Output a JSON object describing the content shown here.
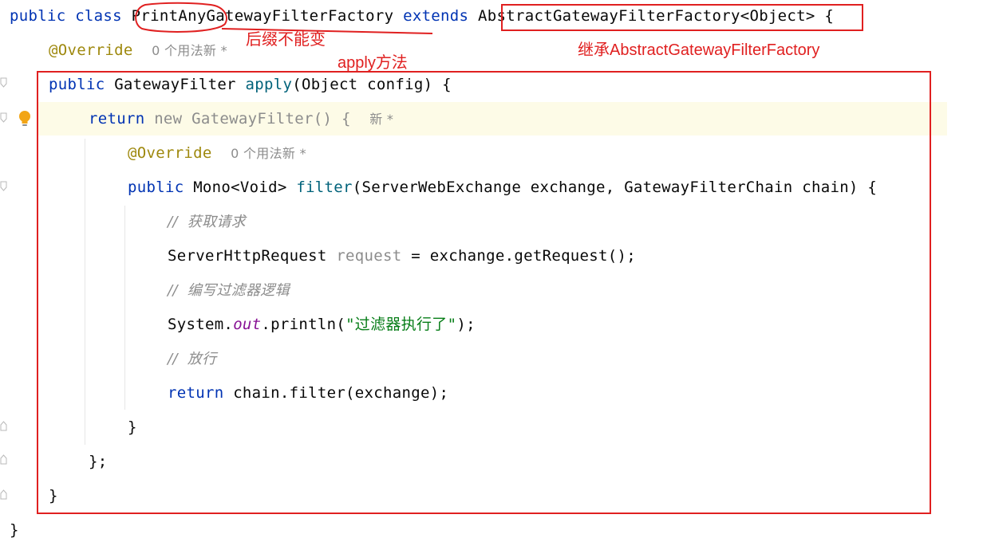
{
  "code": {
    "line1": {
      "kw1": "public",
      "kw2": "class",
      "class_name": "PrintAnyGatewayFilterFactory",
      "kw3": "extends",
      "parent": "AbstractGatewayFilterFactory<Object>",
      "brace": "{"
    },
    "line2": {
      "annotation": "@Override",
      "usages": "0 个用法",
      "mark": "新 *"
    },
    "line3": {
      "kw": "public",
      "type": "GatewayFilter",
      "method": "apply",
      "params": "(Object config) {"
    },
    "line4": {
      "kw": "return",
      "kw_new": "new",
      "type": "GatewayFilter() {",
      "mark": "新 *"
    },
    "line5": {
      "annotation": "@Override",
      "usages": "0 个用法",
      "mark": "新 *"
    },
    "line6": {
      "kw": "public",
      "type": "Mono<Void>",
      "method": "filter",
      "params": "(ServerWebExchange exchange, GatewayFilterChain chain) {"
    },
    "line7": {
      "comment": "//  获取请求"
    },
    "line8": {
      "type": "ServerHttpRequest",
      "var": "request",
      "rest": "= exchange.getRequest();"
    },
    "line9": {
      "comment": "//  编写过滤器逻辑"
    },
    "line10": {
      "pre": "System.",
      "field": "out",
      "call": ".println(",
      "string": "\"过滤器执行了\"",
      "end": ");"
    },
    "line11": {
      "comment": "//  放行"
    },
    "line12": {
      "kw": "return",
      "rest": "chain.filter(exchange);"
    },
    "line13": {
      "text": "}"
    },
    "line14": {
      "text": "};"
    },
    "line15": {
      "text": "}"
    },
    "line16": {
      "text": "}"
    }
  },
  "annotations": {
    "suffix_note": "后缀不能变",
    "apply_note": "apply方法",
    "extends_note": "继承AbstractGatewayFilterFactory"
  },
  "colors": {
    "keyword": "#0033b3",
    "annotation": "#9e880d",
    "method": "#00627a",
    "comment": "#8c8c8c",
    "string": "#067d17",
    "static_field": "#871094",
    "markup_red": "#e02020",
    "line_highlight": "#fdfbe7"
  },
  "icons": {
    "intention": "lightbulb-icon",
    "fold": "fold-marker-icon"
  }
}
